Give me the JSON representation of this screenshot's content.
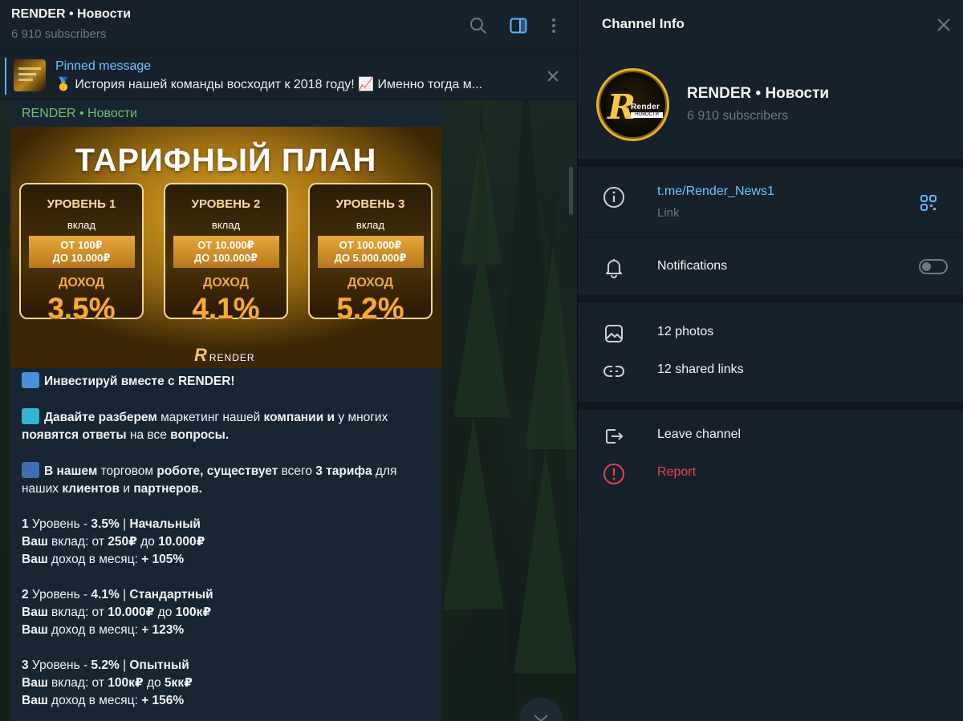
{
  "chat": {
    "title": "RENDER • Новости",
    "subscribers": "6 910 subscribers",
    "pinned": {
      "label": "Pinned message",
      "text": "🥇 История нашей команды восходит к 2018 году! 📈 Именно тогда м..."
    },
    "message": {
      "author": "RENDER • Новости",
      "poster": {
        "title": "ТАРИФНЫЙ ПЛАН",
        "brand_letter": "R",
        "brand": "RENDER",
        "cards": [
          {
            "level": "УРОВЕНЬ 1",
            "deposit_label": "вклад",
            "range_from": "ОТ 100₽",
            "range_to": "ДО 10.000₽",
            "income_label": "ДОХОД",
            "percent": "3.5%"
          },
          {
            "level": "УРОВЕНЬ 2",
            "deposit_label": "вклад",
            "range_from": "ОТ 10.000₽",
            "range_to": "ДО 100.000₽",
            "income_label": "ДОХОД",
            "percent": "4.1%"
          },
          {
            "level": "УРОВЕНЬ 3",
            "deposit_label": "вклад",
            "range_from": "ОТ 100.000₽",
            "range_to": "ДО 5.000.000₽",
            "income_label": "ДОХОД",
            "percent": "5.2%"
          }
        ]
      },
      "lines": [
        {
          "parts": [
            [
              "b",
              "Инвестируй вместе с RENDER!"
            ]
          ],
          "emoji": "chart-up-emoji",
          "emoji_color": "#4a90d9"
        },
        {
          "parts": []
        },
        {
          "parts": [
            [
              "b",
              "Давайте разберем"
            ],
            [
              "n",
              " маркетинг нашей "
            ],
            [
              "b",
              "компании и"
            ],
            [
              "n",
              " у многих"
            ]
          ],
          "emoji": "percent-emoji",
          "emoji_color": "#2fb6d6"
        },
        {
          "parts": [
            [
              "b",
              "появятся ответы"
            ],
            [
              "n",
              " на все "
            ],
            [
              "b",
              "вопросы."
            ]
          ]
        },
        {
          "parts": []
        },
        {
          "parts": [
            [
              "b",
              "В нашем"
            ],
            [
              "n",
              " торговом "
            ],
            [
              "b",
              "роботе, существует"
            ],
            [
              "n",
              " всего "
            ],
            [
              "b",
              "3 тарифа"
            ],
            [
              "n",
              " для"
            ]
          ],
          "emoji": "bar-chart-emoji",
          "emoji_color": "#3f6fb0"
        },
        {
          "parts": [
            [
              "n",
              "наших "
            ],
            [
              "b",
              "клиентов"
            ],
            [
              "n",
              " и "
            ],
            [
              "b",
              "партнеров."
            ]
          ]
        },
        {
          "parts": []
        },
        {
          "parts": [
            [
              "b",
              "1"
            ],
            [
              "n",
              " Уровень - "
            ],
            [
              "b",
              "3.5%"
            ],
            [
              "n",
              " | "
            ],
            [
              "b",
              "Начальный"
            ]
          ]
        },
        {
          "parts": [
            [
              "b",
              "Ваш"
            ],
            [
              "n",
              " вклад: от "
            ],
            [
              "b",
              "250₽"
            ],
            [
              "n",
              " до "
            ],
            [
              "b",
              "10.000₽"
            ]
          ]
        },
        {
          "parts": [
            [
              "b",
              "Ваш"
            ],
            [
              "n",
              " доход в месяц: "
            ],
            [
              "b",
              "+ 105%"
            ]
          ]
        },
        {
          "parts": []
        },
        {
          "parts": [
            [
              "b",
              "2"
            ],
            [
              "n",
              " Уровень - "
            ],
            [
              "b",
              "4.1%"
            ],
            [
              "n",
              " | "
            ],
            [
              "b",
              "Стандартный"
            ]
          ]
        },
        {
          "parts": [
            [
              "b",
              "Ваш"
            ],
            [
              "n",
              " вклад: от "
            ],
            [
              "b",
              "10.000₽"
            ],
            [
              "n",
              " до "
            ],
            [
              "b",
              "100к₽"
            ]
          ]
        },
        {
          "parts": [
            [
              "b",
              "Ваш"
            ],
            [
              "n",
              " доход в месяц: "
            ],
            [
              "b",
              "+ 123%"
            ]
          ]
        },
        {
          "parts": []
        },
        {
          "parts": [
            [
              "b",
              "3"
            ],
            [
              "n",
              " Уровень - "
            ],
            [
              "b",
              "5.2%"
            ],
            [
              "n",
              " | "
            ],
            [
              "b",
              "Опытный"
            ]
          ]
        },
        {
          "parts": [
            [
              "b",
              "Ваш"
            ],
            [
              "n",
              " вклад: от "
            ],
            [
              "b",
              "100к₽"
            ],
            [
              "n",
              " до "
            ],
            [
              "b",
              "5кк₽"
            ]
          ]
        },
        {
          "parts": [
            [
              "b",
              "Ваш"
            ],
            [
              "n",
              " доход в месяц: "
            ],
            [
              "b",
              "+ 156%"
            ]
          ]
        }
      ]
    }
  },
  "info": {
    "header": "Channel Info",
    "name": "RENDER • Новости",
    "subscribers": "6 910 subscribers",
    "avatar": {
      "letter": "R",
      "word": "Render",
      "tag": "НОВОСТИ"
    },
    "link": {
      "url": "t.me/Render_News1",
      "label": "Link"
    },
    "notifications": {
      "label": "Notifications",
      "enabled": false
    },
    "photos": "12 photos",
    "shared_links": "12 shared links",
    "leave": "Leave channel",
    "report": "Report",
    "colors": {
      "accent": "#6ec4ff",
      "danger": "#e5444b",
      "author": "#6dc26e"
    }
  }
}
